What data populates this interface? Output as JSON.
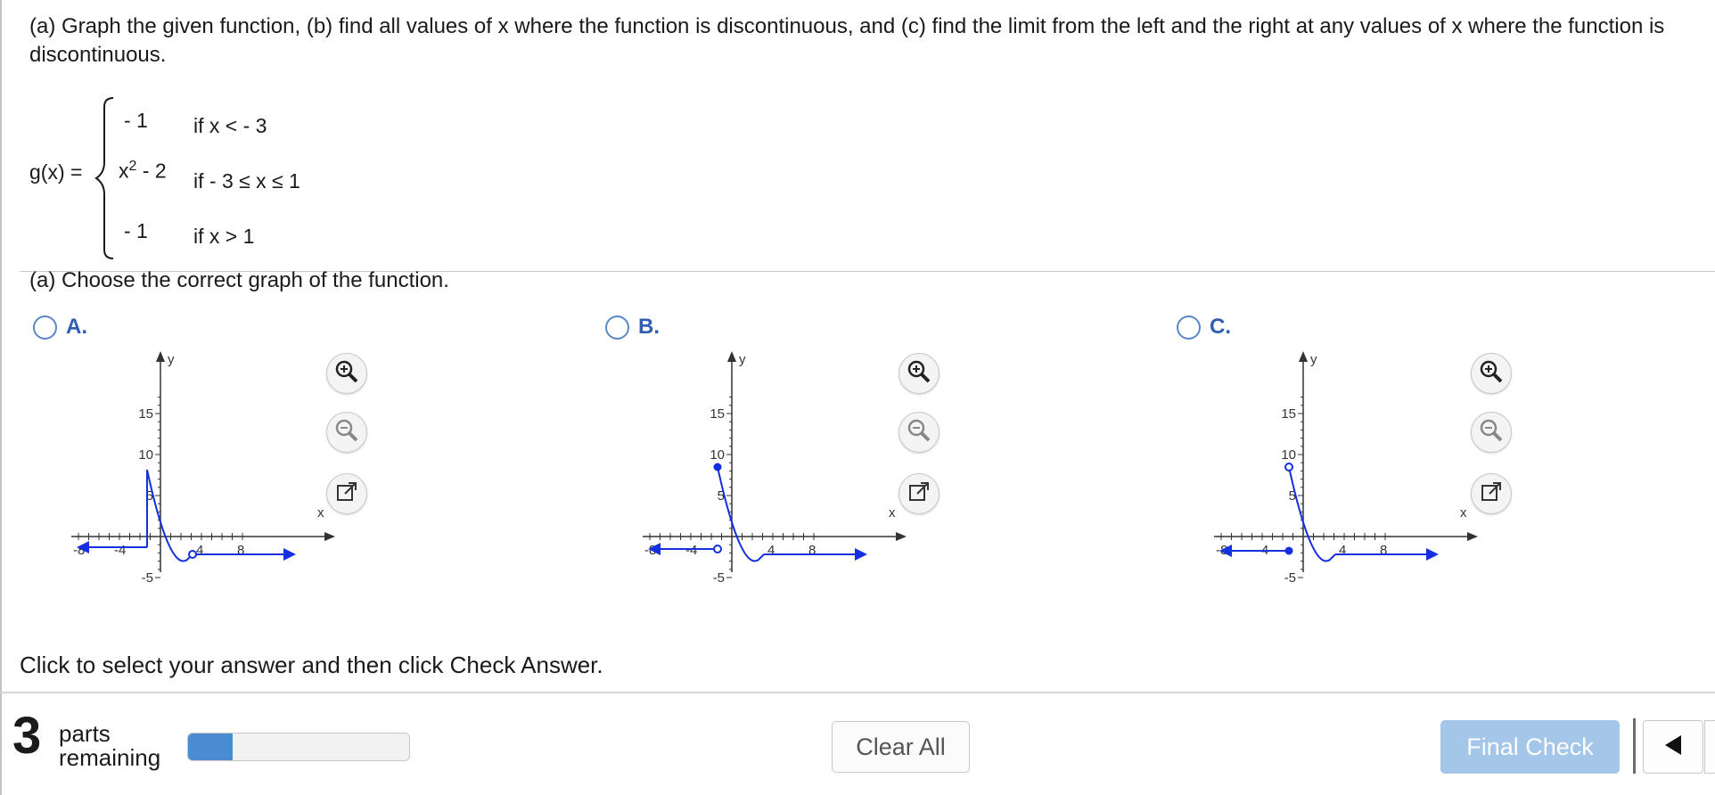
{
  "question": {
    "text": "(a) Graph the given function, (b) find all values of x where the function is discontinuous, and (c) find the limit from the left and the right at any values of x where the function is discontinuous."
  },
  "function": {
    "name": "g(x) =",
    "pieces": [
      {
        "value": "- 1",
        "condition": "if x < - 3"
      },
      {
        "value_base": "x",
        "value_exp": "2",
        "value_rest": " - 2",
        "condition": "if - 3 ≤ x ≤ 1"
      },
      {
        "value": "- 1",
        "condition": "if x > 1"
      }
    ]
  },
  "part_a": {
    "prompt": "(a) Choose the correct graph of the function."
  },
  "options": [
    {
      "letter": "A."
    },
    {
      "letter": "B."
    },
    {
      "letter": "C."
    }
  ],
  "graph_axes": {
    "x_label": "x",
    "y_label": "y",
    "x_ticks": [
      "-8",
      "-4",
      "4",
      "8"
    ],
    "y_ticks": [
      "15",
      "10",
      "5",
      "-5"
    ]
  },
  "tools": {
    "zoom_in_icon": "zoom-in-icon",
    "zoom_out_icon": "zoom-out-icon",
    "popout_icon": "popout-icon"
  },
  "instruction": "Click to select your answer and then click Check Answer.",
  "footer": {
    "parts_count": "3",
    "parts_label_1": "parts",
    "parts_label_2": "remaining",
    "progress_fraction": 0.2,
    "clear_label": "Clear All",
    "final_label": "Final Check"
  },
  "colors": {
    "curve": "#1530e0",
    "accent": "#2f5fb3",
    "final_button": "#a4c6e8",
    "progress_fill": "#4a8bd1"
  }
}
